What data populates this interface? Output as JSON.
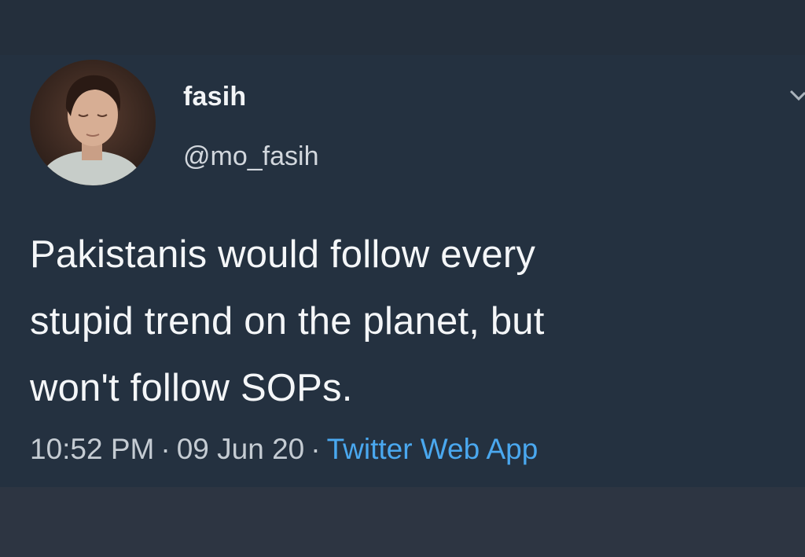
{
  "tweet": {
    "display_name": "fasih",
    "handle": "@mo_fasih",
    "text": "Pakistanis would follow every\nstupid trend on the planet, but\nwon't follow SOPs.",
    "time": "10:52 PM",
    "separator": "·",
    "date": "09 Jun 20",
    "source": "Twitter Web App"
  },
  "icons": {
    "avatar": "profile-photo",
    "menu": "chevron-down-icon"
  },
  "colors": {
    "background": "#243140",
    "text": "#f4f6f8",
    "secondary_text": "#c5ccd3",
    "link": "#4aa8ef"
  }
}
